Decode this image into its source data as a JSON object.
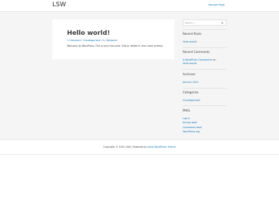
{
  "header": {
    "site_title": "LSW",
    "nav_link": "Sample Page"
  },
  "post": {
    "title": "Hello world!",
    "meta": {
      "comments": "1 Comment",
      "category": "Uncategorized",
      "author_prefix": "By",
      "author": "Benjamin"
    },
    "body": "Welcome to WordPress. This is your first post. Edit or delete it, then start writing!"
  },
  "sidebar": {
    "search_placeholder": "Search ...",
    "recent_posts": {
      "title": "Recent Posts",
      "items": [
        "Hello world!"
      ]
    },
    "recent_comments": {
      "title": "Recent Comments",
      "item_author": "A WordPress Commenter",
      "item_on": "on",
      "item_post": "Hello world!"
    },
    "archives": {
      "title": "Archives",
      "items": [
        "January 2021"
      ]
    },
    "categories": {
      "title": "Categories",
      "items": [
        "Uncategorized"
      ]
    },
    "meta": {
      "title": "Meta",
      "items": [
        "Log in",
        "Entries feed",
        "Comments feed",
        "WordPress.org"
      ]
    }
  },
  "footer": {
    "copyright": "Copyright © 2021 LSW | Powered by",
    "theme_link": "Astra WordPress Theme"
  },
  "colors": {
    "link": "#0274be",
    "text": "#3a3a3a",
    "background": "#f5f5f5"
  }
}
